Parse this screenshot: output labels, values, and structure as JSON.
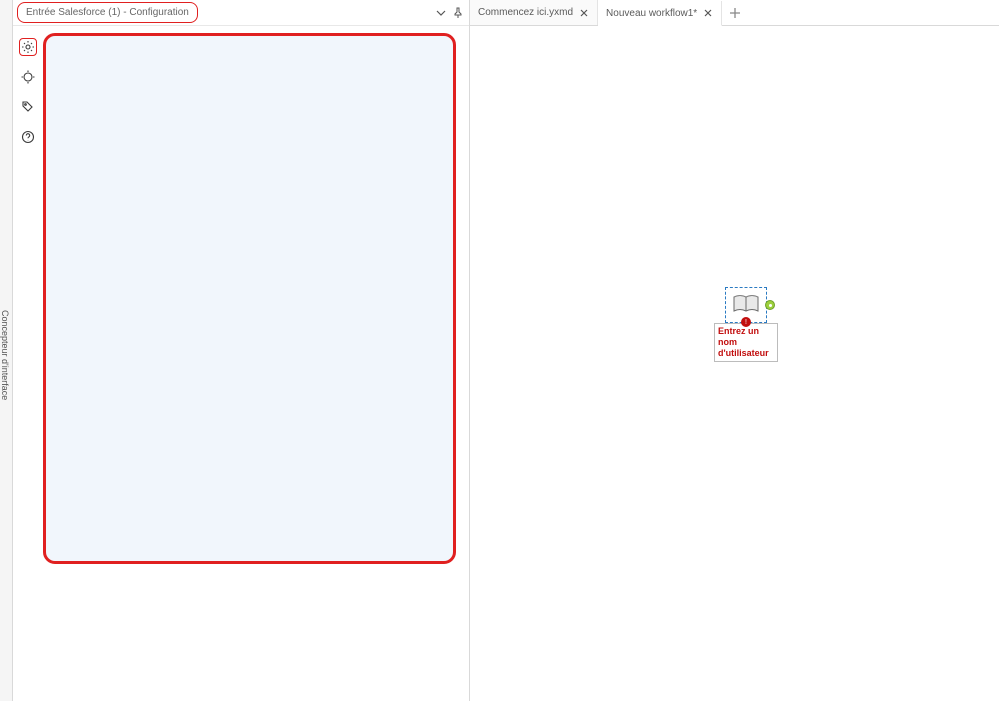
{
  "vrail": {
    "label": "Concepteur d'interface"
  },
  "config_panel": {
    "title": "Entrée Salesforce (1) - Configuration",
    "tools": [
      {
        "name": "gear-icon",
        "active": true
      },
      {
        "name": "target-icon",
        "active": false
      },
      {
        "name": "tag-icon",
        "active": false
      },
      {
        "name": "help-icon",
        "active": false
      }
    ]
  },
  "tabs": [
    {
      "label": "Commencez ici.yxmd",
      "active": false
    },
    {
      "label": "Nouveau workflow1*",
      "active": true
    }
  ],
  "canvas_node": {
    "error_label": "Entrez un nom d'utilisateur",
    "alert_glyph": "!"
  }
}
